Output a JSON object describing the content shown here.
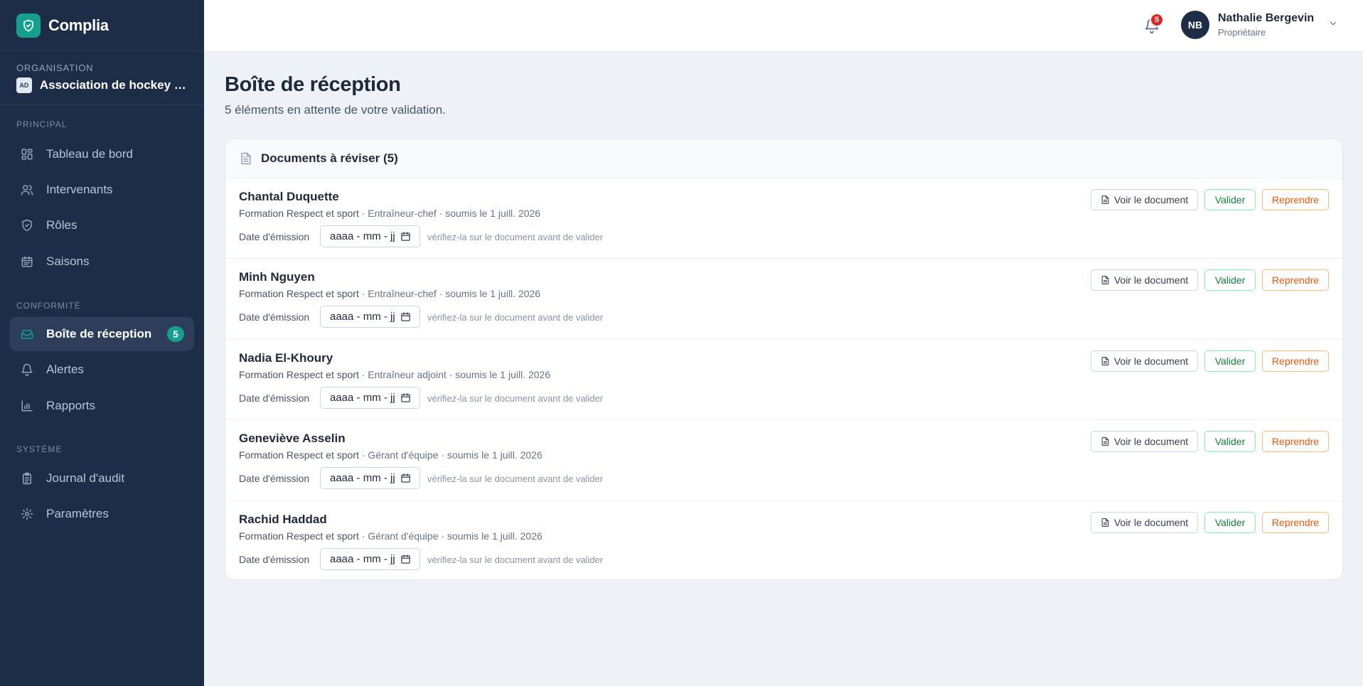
{
  "app": {
    "name": "Complia"
  },
  "organisation": {
    "label": "ORGANISATION",
    "badge": "AD",
    "name": "Association de hockey mineur"
  },
  "sidebar": {
    "sections": [
      {
        "label": "PRINCIPAL"
      },
      {
        "label": "CONFORMITÉ"
      },
      {
        "label": "SYSTÈME"
      }
    ],
    "items": [
      {
        "label": "Tableau de bord",
        "icon": "dashboard-icon"
      },
      {
        "label": "Intervenants",
        "icon": "users-icon"
      },
      {
        "label": "Rôles",
        "icon": "shield-icon"
      },
      {
        "label": "Saisons",
        "icon": "calendar-icon"
      },
      {
        "label": "Boîte de réception",
        "icon": "inbox-icon",
        "count": "5",
        "active": true
      },
      {
        "label": "Alertes",
        "icon": "bell-icon"
      },
      {
        "label": "Rapports",
        "icon": "bar-chart-icon"
      },
      {
        "label": "Journal d'audit",
        "icon": "clipboard-icon"
      },
      {
        "label": "Paramètres",
        "icon": "gear-icon"
      }
    ]
  },
  "topbar": {
    "notifications_count": "5",
    "user": {
      "initials": "NB",
      "name": "Nathalie Bergevin",
      "role": "Propriétaire"
    }
  },
  "page": {
    "title": "Boîte de réception",
    "subtitle": "5 éléments en attente de votre validation."
  },
  "documents": {
    "title": "Documents à réviser (5)",
    "date_label": "Date d'émission",
    "date_placeholder": "aaaa - mm - jj",
    "hint": "vérifiez-la sur le document avant de valider",
    "actions": {
      "view": "Voir le document",
      "validate": "Valider",
      "retake": "Reprendre"
    },
    "rows": [
      {
        "name": "Chantal Duquette",
        "training": "Formation Respect et sport",
        "details": " · Entraîneur-chef · soumis le 1 juill. 2026"
      },
      {
        "name": "Minh Nguyen",
        "training": "Formation Respect et sport",
        "details": " · Entraîneur-chef · soumis le 1 juill. 2026"
      },
      {
        "name": "Nadia El-Khoury",
        "training": "Formation Respect et sport",
        "details": " · Entraîneur adjoint · soumis le 1 juill. 2026"
      },
      {
        "name": "Geneviève Asselin",
        "training": "Formation Respect et sport",
        "details": " · Gérant d'équipe · soumis le 1 juill. 2026"
      },
      {
        "name": "Rachid Haddad",
        "training": "Formation Respect et sport",
        "details": " · Gérant d'équipe · soumis le 1 juill. 2026"
      }
    ]
  },
  "colors": {
    "sidebar": "#1d2d48",
    "accent": "#14a08c",
    "validate": "#15803d",
    "retake": "#ea580c",
    "badge": "#dc2626"
  }
}
